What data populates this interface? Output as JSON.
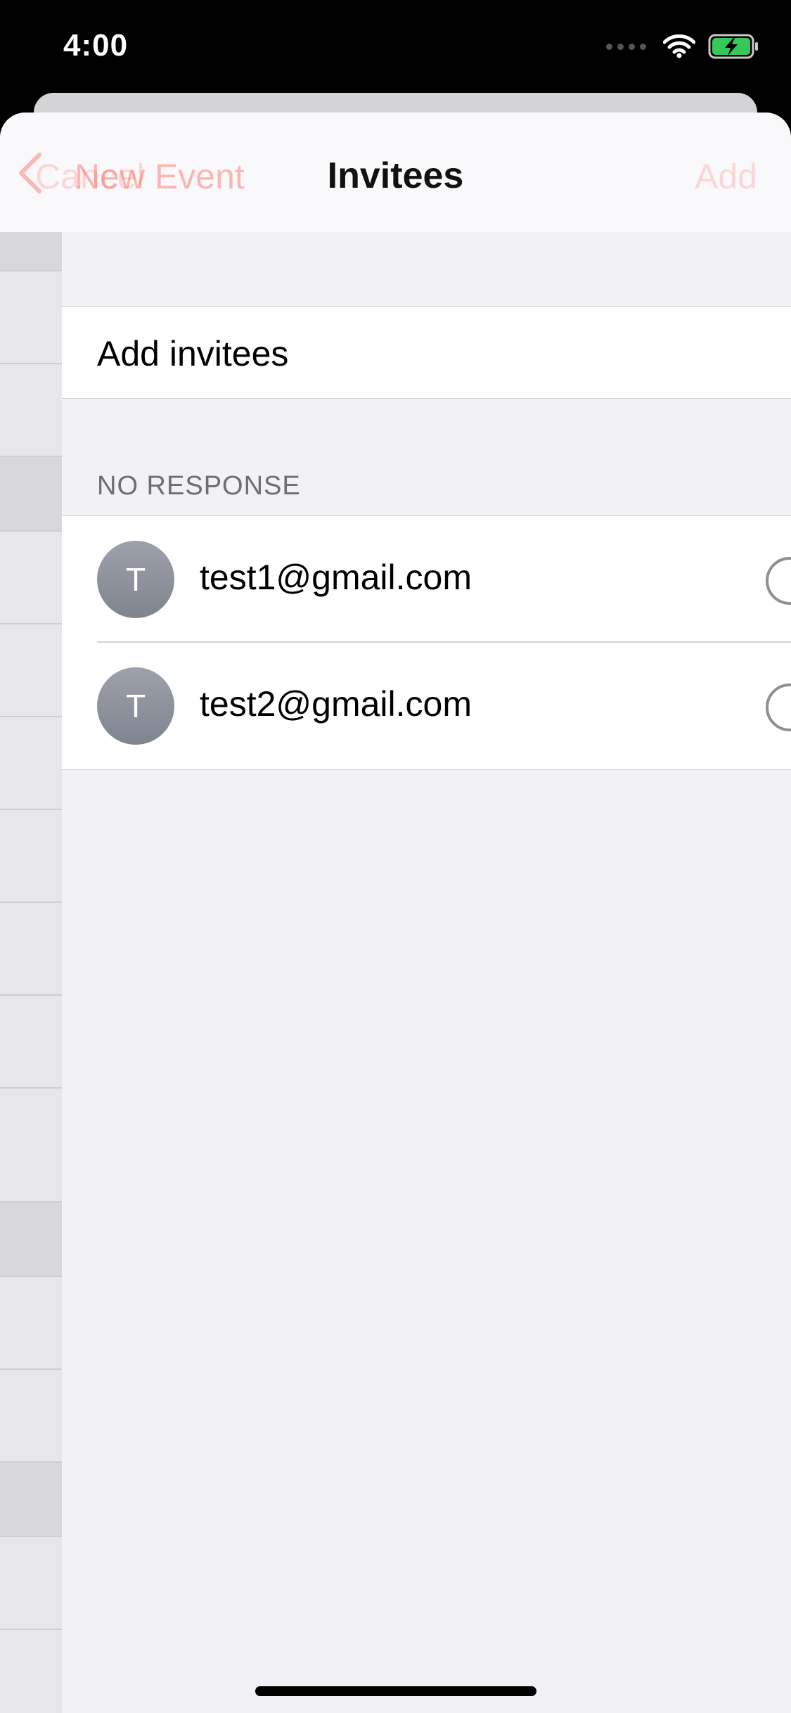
{
  "status_bar": {
    "time": "4:00"
  },
  "nav": {
    "ghost_label": "Cancel",
    "back_label": "New Event",
    "title": "Invitees",
    "add_label": "Add"
  },
  "add_invitees": {
    "label": "Add invitees"
  },
  "section": {
    "header": "NO RESPONSE"
  },
  "invitees": [
    {
      "initial": "T",
      "email": "test1@gmail.com"
    },
    {
      "initial": "T",
      "email": "test2@gmail.com"
    }
  ],
  "colors": {
    "accent": "#ff3b30",
    "battery": "#34c759"
  },
  "icons": [
    "signal-dots-icon",
    "wifi-icon",
    "battery-charging-icon",
    "back-chevron-icon",
    "info-icon"
  ]
}
